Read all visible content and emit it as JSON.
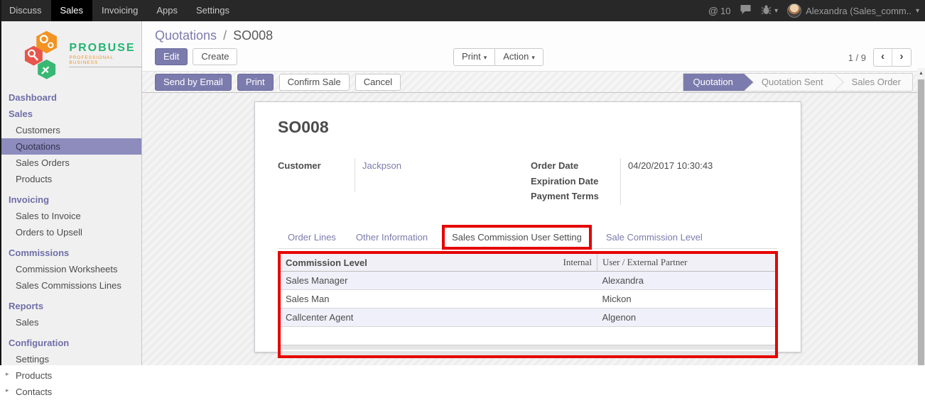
{
  "topbar": {
    "menus": [
      {
        "label": "Discuss"
      },
      {
        "label": "Sales"
      },
      {
        "label": "Invoicing"
      },
      {
        "label": "Apps"
      },
      {
        "label": "Settings"
      }
    ],
    "mention": {
      "glyph": "@",
      "count": "10"
    },
    "user_name": "Alexandra (Sales_comm..",
    "caret_glyph": "▾"
  },
  "sidebar": {
    "logo": {
      "brand": "PROBUSE",
      "tagline": "PROFESSIONAL BUSINESS"
    },
    "expand_glyph": "▸",
    "sections": [
      {
        "title": "Dashboard",
        "items": []
      },
      {
        "title": "Sales",
        "items": [
          {
            "label": "Customers"
          },
          {
            "label": "Quotations"
          },
          {
            "label": "Sales Orders"
          },
          {
            "label": "Products"
          }
        ]
      },
      {
        "title": "Invoicing",
        "items": [
          {
            "label": "Sales to Invoice"
          },
          {
            "label": "Orders to Upsell"
          }
        ]
      },
      {
        "title": "Commissions",
        "items": [
          {
            "label": "Commission Worksheets"
          },
          {
            "label": "Sales Commissions Lines"
          }
        ]
      },
      {
        "title": "Reports",
        "items": [
          {
            "label": "Sales"
          }
        ]
      },
      {
        "title": "Configuration",
        "items": [
          {
            "label": "Settings"
          },
          {
            "label": "Products"
          },
          {
            "label": "Contacts"
          }
        ]
      }
    ]
  },
  "control_panel": {
    "breadcrumb": {
      "parent": "Quotations",
      "separator": "/",
      "current": "SO008"
    },
    "edit_label": "Edit",
    "create_label": "Create",
    "print_label": "Print",
    "action_label": "Action",
    "caret_glyph": "▾",
    "pager": {
      "value": "1 / 9",
      "prev_glyph": "‹",
      "next_glyph": "›"
    }
  },
  "statusbar": {
    "buttons": [
      {
        "label": "Send by Email"
      },
      {
        "label": "Print"
      },
      {
        "label": "Confirm Sale"
      },
      {
        "label": "Cancel"
      }
    ],
    "steps": [
      {
        "label": "Quotation"
      },
      {
        "label": "Quotation Sent"
      },
      {
        "label": "Sales Order"
      }
    ]
  },
  "form": {
    "title": "SO008",
    "customer": {
      "label": "Customer",
      "value": "Jackpson"
    },
    "right_fields": [
      {
        "label": "Order Date",
        "value": "04/20/2017 10:30:43"
      },
      {
        "label": "Expiration Date",
        "value": ""
      },
      {
        "label": "Payment Terms",
        "value": ""
      }
    ],
    "tabs": [
      {
        "label": "Order Lines"
      },
      {
        "label": "Other Information"
      },
      {
        "label": "Sales Commission User Setting"
      },
      {
        "label": "Sale Commission Level"
      }
    ],
    "table": {
      "header_level": "Commission Level",
      "header_internal": "Internal",
      "header_user": "User / External Partner",
      "rows": [
        {
          "level": "Sales Manager",
          "user": "Alexandra"
        },
        {
          "level": "Sales Man",
          "user": "Mickon"
        },
        {
          "level": "Callcenter Agent",
          "user": "Algenon"
        }
      ]
    }
  },
  "scrollbar": {
    "up_glyph": "▲"
  },
  "colors": {
    "accent": "#7c7bad",
    "annotation": "#e60000",
    "topbar_bg": "#282828",
    "brand_green": "#21b573",
    "brand_orange": "#f29322"
  }
}
